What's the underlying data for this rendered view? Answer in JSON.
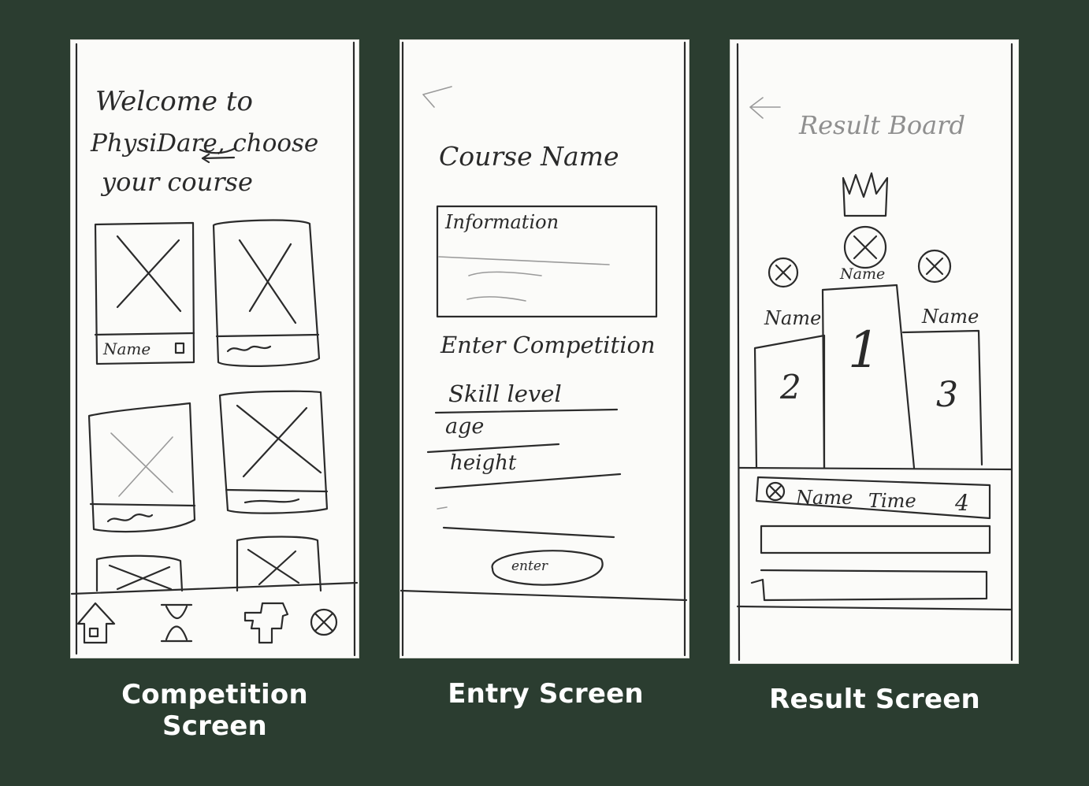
{
  "competition_screen": {
    "caption_line1": "Competition",
    "caption_line2": "Screen",
    "welcome_line1": "Welcome to",
    "welcome_line2": "PhysiDare, choose",
    "welcome_line3": "your course",
    "card1_label": "Name",
    "nav_icons": [
      "home-icon",
      "hourglass-icon",
      "puzzle-icon",
      "avatar-placeholder-icon"
    ]
  },
  "entry_screen": {
    "caption": "Entry Screen",
    "course_title": "Course Name",
    "info_label": "Information",
    "enter_competition": "Enter Competition",
    "fields": [
      "Skill level",
      "age",
      "height"
    ],
    "enter_button": "enter"
  },
  "result_screen": {
    "caption": "Result Screen",
    "title": "Result Board",
    "podium": {
      "first": {
        "name": "Name",
        "rank": "1"
      },
      "second": {
        "name": "Name",
        "rank": "2"
      },
      "third": {
        "name": "Name",
        "rank": "3"
      }
    },
    "row1": {
      "name": "Name",
      "time": "Time",
      "rank": "4"
    }
  }
}
